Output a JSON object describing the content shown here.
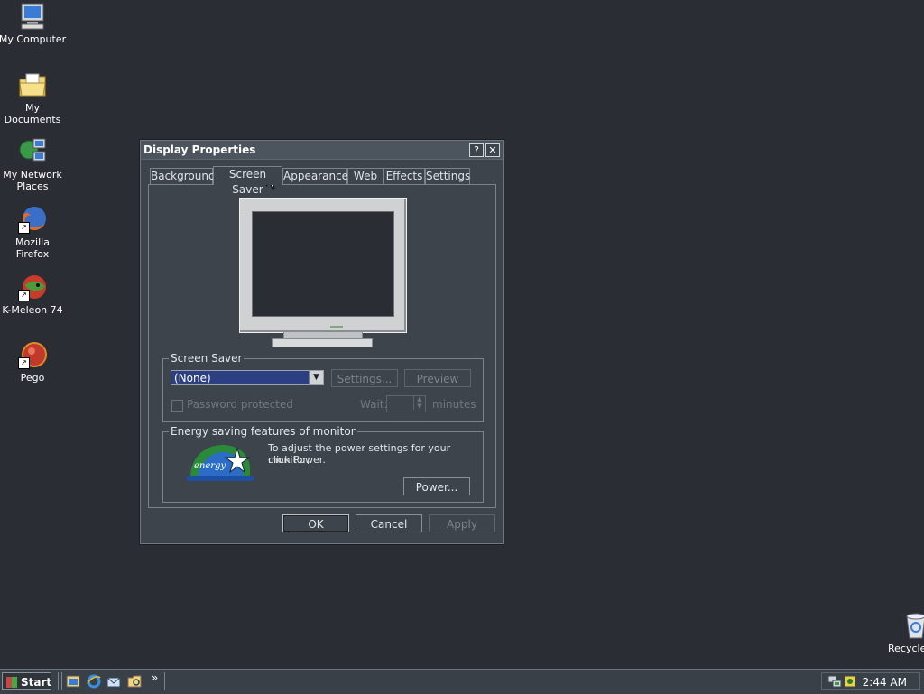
{
  "desktop": {
    "icons": [
      {
        "label": "My Computer",
        "icon": "computer-icon"
      },
      {
        "label": "My Documents",
        "icon": "folder-documents-icon"
      },
      {
        "label": "My Network",
        "label2": "Places",
        "icon": "network-places-icon"
      },
      {
        "label": "Mozilla Firefox",
        "icon": "firefox-icon"
      },
      {
        "label": "K-Meleon 74",
        "icon": "kmeleon-icon"
      },
      {
        "label": "Pego",
        "icon": "pego-icon"
      },
      {
        "label": "Recycle",
        "icon": "recycle-bin-icon"
      }
    ]
  },
  "dialog": {
    "title": "Display Properties",
    "help_btn": "?",
    "close_btn": "✕",
    "tabs": [
      "Background",
      "Screen Saver",
      "Appearance",
      "Web",
      "Effects",
      "Settings"
    ],
    "active_tab": "Screen Saver",
    "screensaver": {
      "group_label": "Screen Saver",
      "selected": "(None)",
      "settings_btn": "Settings...",
      "preview_btn": "Preview",
      "password_label": "Password protected",
      "wait_label": "Wait:",
      "wait_value": "",
      "minutes_label": "minutes"
    },
    "energy": {
      "group_label": "Energy saving features of monitor",
      "text_line1": "To adjust the power settings for your monitor,",
      "text_line2": "click Power.",
      "power_btn": "Power...",
      "logo_text": "energy"
    },
    "ok_btn": "OK",
    "cancel_btn": "Cancel",
    "apply_btn": "Apply"
  },
  "taskbar": {
    "start_label": "Start",
    "chevron": "»",
    "clock": "2:44 AM"
  }
}
